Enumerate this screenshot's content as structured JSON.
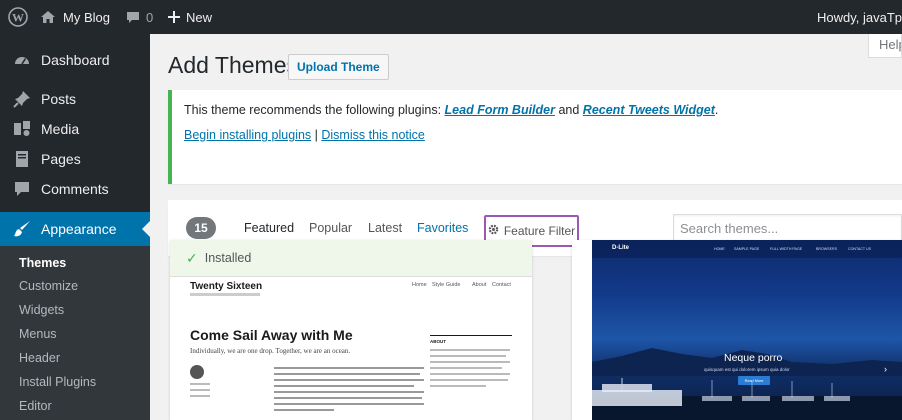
{
  "adminbar": {
    "site_name": "My Blog",
    "comment_count": "0",
    "new_label": "New",
    "howdy": "Howdy, javaTp"
  },
  "sidebar": {
    "items": [
      {
        "label": "Dashboard",
        "icon": "dashboard-icon"
      },
      {
        "label": "Posts",
        "icon": "pin-icon"
      },
      {
        "label": "Media",
        "icon": "media-icon"
      },
      {
        "label": "Pages",
        "icon": "pages-icon"
      },
      {
        "label": "Comments",
        "icon": "comment-icon"
      },
      {
        "label": "Appearance",
        "icon": "brush-icon"
      }
    ],
    "submenu": [
      "Themes",
      "Customize",
      "Widgets",
      "Menus",
      "Header",
      "Install Plugins",
      "Editor"
    ]
  },
  "header": {
    "title": "Add Themes",
    "upload_label": "Upload Theme",
    "help_label": "Help"
  },
  "notice": {
    "text_before": "This theme recommends the following plugins: ",
    "plugin1": "Lead Form Builder",
    "and": " and ",
    "plugin2": "Recent Tweets Widget",
    "period": ".",
    "begin_link": "Begin installing plugins",
    "separator": " | ",
    "dismiss_link": "Dismiss this notice"
  },
  "filter": {
    "count": "15",
    "tabs": [
      "Featured",
      "Popular",
      "Latest",
      "Favorites"
    ],
    "feature_filter": "Feature Filter",
    "search_placeholder": "Search themes..."
  },
  "themes": [
    {
      "installed_label": "Installed",
      "preview_title": "Twenty Sixteen",
      "nav": [
        "Home",
        "Style Guide",
        "About",
        "Contact"
      ],
      "hero_title": "Come Sail Away with Me",
      "hero_sub": "Individually, we are one drop. Together, we are an ocean.",
      "about_label": "ABOUT"
    },
    {
      "logo": "D-Lite",
      "nav": [
        "HOME",
        "SAMPLE PAGE",
        "FULL WIDTH PAGE",
        "BROWSERS",
        "CONTACT US"
      ],
      "hero_title": "Neque porro",
      "hero_sub": "quisquam est qui dolorem ipsum quia dolor",
      "button": "Read More"
    }
  ],
  "colors": {
    "adminbar": "#23282d",
    "accent": "#0073aa",
    "notice_border": "#46b450",
    "highlight_box": "#9b59b6"
  }
}
